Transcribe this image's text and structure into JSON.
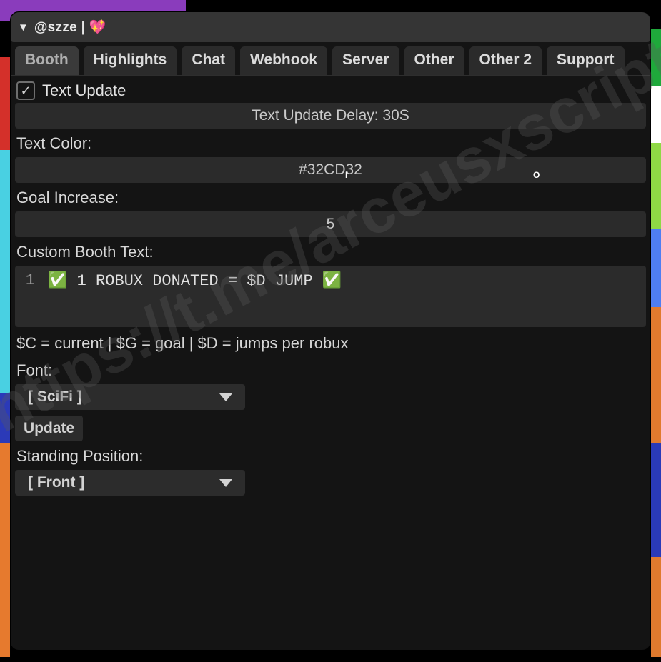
{
  "watermark": "https://t.me/arceusxscripts",
  "titlebar": {
    "title": "@szze | 💖"
  },
  "tabs": {
    "items": [
      "Booth",
      "Highlights",
      "Chat",
      "Webhook",
      "Server",
      "Other",
      "Other 2",
      "Support"
    ],
    "active": 0
  },
  "section": {
    "textUpdateCheck": {
      "label": "Text Update",
      "checked": true
    },
    "delayBar": "Text Update Delay: 30S",
    "textColorLabel": "Text Color:",
    "textColorValue": "#32CD32",
    "goalIncreaseLabel": "Goal Increase:",
    "goalIncreaseValue": "5",
    "customBoothLabel": "Custom Booth Text:",
    "customBooth": {
      "lineNo": "1",
      "content": "✅ 1 ROBUX DONATED = $D JUMP ✅"
    },
    "legend": "$C = current | $G = goal | $D = jumps per robux",
    "fontLabel": "Font:",
    "fontValue": "[ SciFi ]",
    "updateBtn": "Update",
    "standingLabel": "Standing Position:",
    "standingValue": "[ Front ]"
  }
}
